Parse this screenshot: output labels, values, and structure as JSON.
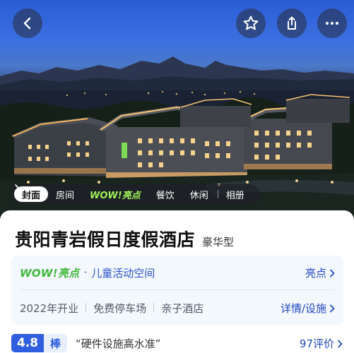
{
  "colors": {
    "primary_blue": "#2f5fe0",
    "link_blue": "#1f47bf",
    "wow_green": "#3fb83a",
    "highlight_bg": "#f3f7fe"
  },
  "header": {
    "back_icon": "chevron-left-icon",
    "favorite_icon": "star-outline-icon",
    "share_icon": "share-icon",
    "more_icon": "ellipsis-icon"
  },
  "photo_tabs": {
    "items": [
      {
        "label": "封面",
        "active": true
      },
      {
        "label": "房间",
        "active": false
      },
      {
        "label": "WOW!亮点",
        "active": false
      },
      {
        "label": "餐饮",
        "active": false
      },
      {
        "label": "休闲",
        "active": false
      },
      {
        "label": "相册",
        "active": false
      }
    ]
  },
  "hotel": {
    "name": "贵阳青岩假日度假酒店",
    "type": "豪华型"
  },
  "highlight": {
    "wow_logo": "WOW!亮点",
    "separator": "·",
    "text": "儿童活动空间",
    "link": "亮点"
  },
  "features": {
    "items": [
      "2022年开业",
      "免费停车场",
      "亲子酒店"
    ],
    "detail_link": "详情/设施"
  },
  "rating": {
    "score": "4.8",
    "label": "棒",
    "quote": "“硬件设施高水准”",
    "review_count": "97评价"
  }
}
